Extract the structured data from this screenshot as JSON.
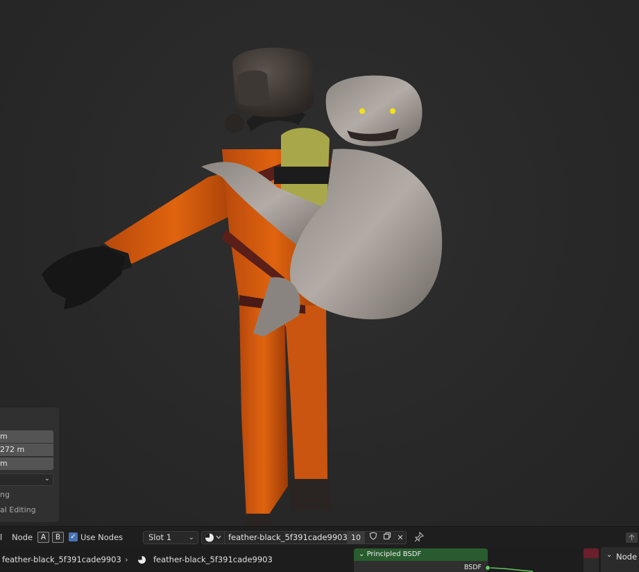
{
  "viewport": {
    "scene_description": "3D render of orange suited astronaut carrying a furry creature",
    "adjust_panel": {
      "field_1": "m",
      "field_2": "272 m",
      "field_3": "m",
      "label_1": "ng",
      "label_2": "al Editing"
    }
  },
  "node_header": {
    "menu_node": "Node",
    "toggle_a": "A",
    "toggle_b": "B",
    "use_nodes_label": "Use Nodes",
    "use_nodes_checked": true,
    "slot_label": "Slot 1",
    "material_name": "feather-black_5f391cade9903",
    "user_count": "10"
  },
  "node_canvas": {
    "breadcrumb_object": "feather-black_5f391cade9903",
    "breadcrumb_material": "feather-black_5f391cade9903",
    "principled_node_title": "Principled BSDF",
    "principled_output": "BSDF",
    "sidebar_tab": "Node"
  },
  "colors": {
    "accent_blue": "#4772b3",
    "shader_socket": "#63c763",
    "shader_node_header": "#285c2e"
  }
}
